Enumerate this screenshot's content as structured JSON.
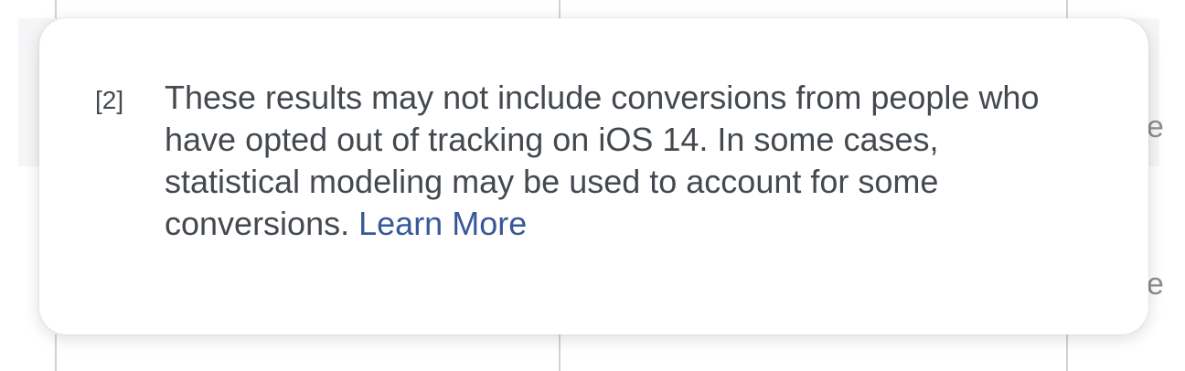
{
  "tooltip": {
    "footnote_marker": "[2]",
    "body_text": "These results may not include conversions from people who have opted out of tracking on iOS 14. In some cases, statistical modeling may be used to account for some conversions.",
    "link_label": "Learn More"
  },
  "background": {
    "edge_glyph_top": "e",
    "edge_glyph_bottom": "e"
  },
  "colors": {
    "text": "#444950",
    "link": "#385898",
    "divider": "#cfd3d8"
  }
}
